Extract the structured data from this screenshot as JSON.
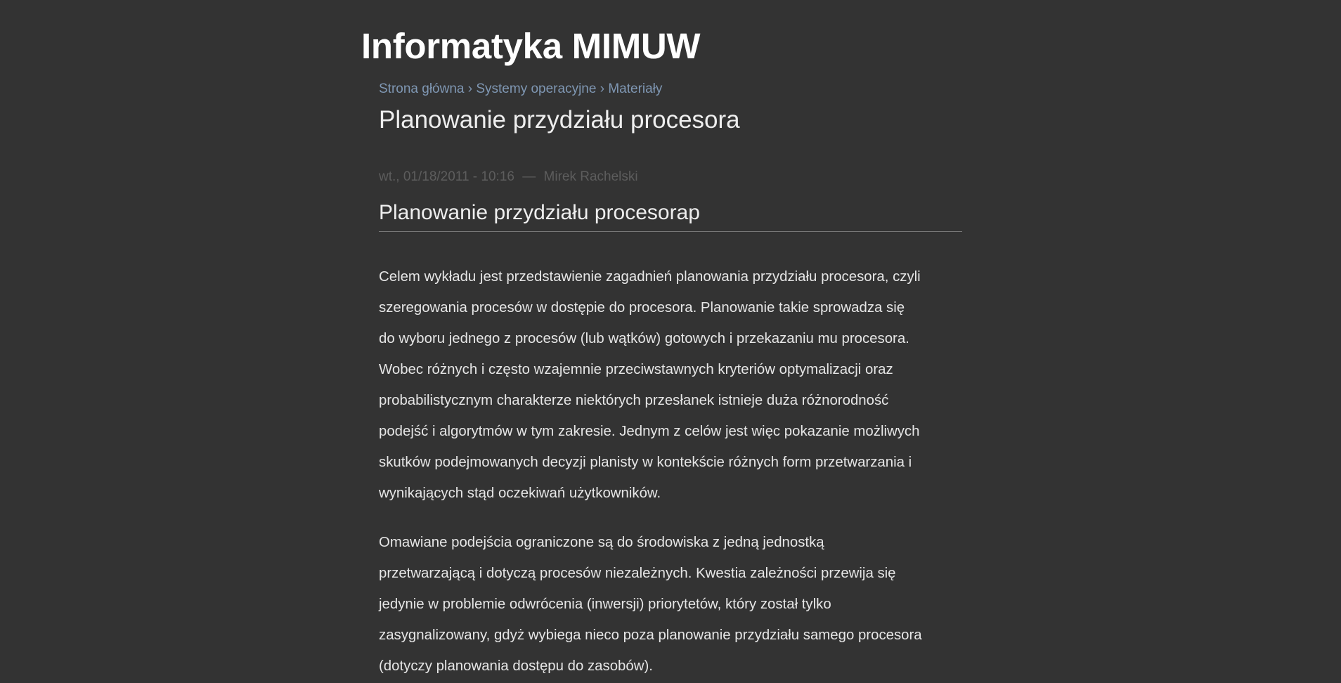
{
  "site": {
    "title": "Informatyka MIMUW"
  },
  "breadcrumb": {
    "items": [
      "Strona główna",
      "Systemy operacyjne",
      "Materiały"
    ],
    "separator": "›"
  },
  "page": {
    "title": "Planowanie przydziału procesora"
  },
  "meta": {
    "date": "wt., 01/18/2011 - 10:16",
    "separator": "—",
    "author": "Mirek Rachelski"
  },
  "article": {
    "title": "Planowanie przydziału procesorap",
    "paragraphs": [
      [
        "Celem wykładu jest przedstawienie zagadnień planowania przydziału procesora, czyli",
        "szeregowania procesów w dostępie do procesora. Planowanie takie sprowadza się",
        "do wyboru jednego z procesów (lub wątków) gotowych i przekazaniu mu procesora.",
        "Wobec różnych i często wzajemnie przeciwstawnych kryteriów optymalizacji oraz",
        "probabilistycznym charakterze niektórych przesłanek istnieje duża różnorodność",
        "podejść i algorytmów w tym zakresie. Jednym z celów jest więc pokazanie możliwych",
        "skutków podejmowanych decyzji planisty w kontekście różnych form przetwarzania i",
        "wynikających stąd oczekiwań użytkowników."
      ],
      [
        "Omawiane podejścia ograniczone są do środowiska z jedną jednostką",
        "przetwarzającą i dotyczą procesów niezależnych. Kwestia zależności przewija się",
        "jedynie w problemie odwrócenia (inwersji) priorytetów, który został tylko",
        "zasygnalizowany, gdyż wybiega nieco poza planowanie przydziału samego procesora",
        "(dotyczy planowania dostępu do zasobów)."
      ]
    ]
  },
  "colors": {
    "background": "#333333",
    "link": "#7f97b3",
    "text": "#e6e6e6",
    "meta": "#5d5d5d"
  }
}
